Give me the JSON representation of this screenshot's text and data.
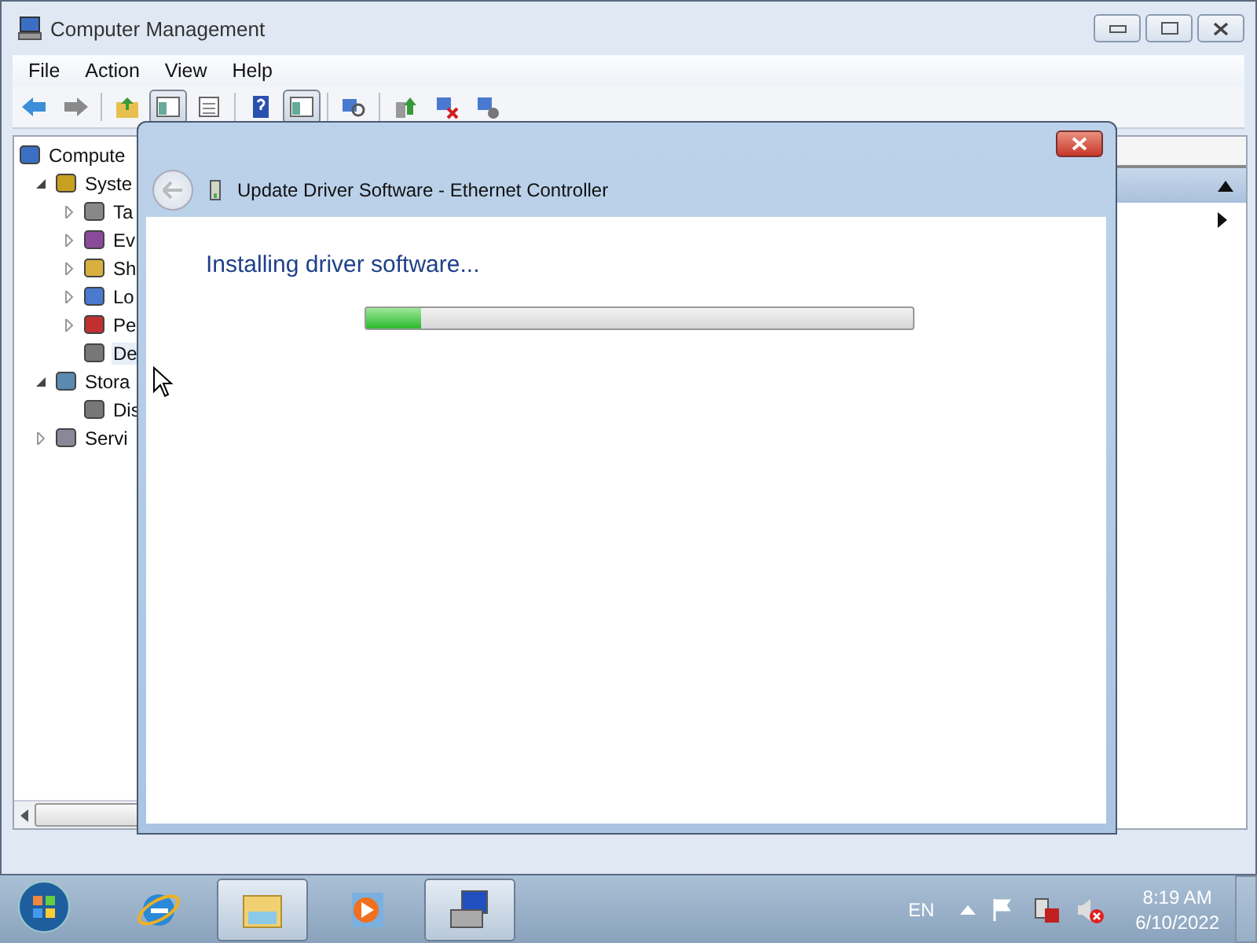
{
  "window": {
    "title": "Computer Management"
  },
  "menu": [
    "File",
    "Action",
    "View",
    "Help"
  ],
  "toolbar": [
    {
      "kind": "back",
      "pressed": false
    },
    {
      "kind": "forward",
      "pressed": false
    },
    {
      "kind": "folder",
      "pressed": false
    },
    {
      "kind": "pane",
      "pressed": true
    },
    {
      "kind": "list",
      "pressed": false
    },
    {
      "kind": "help",
      "pressed": false
    },
    {
      "kind": "pane",
      "pressed": true
    },
    {
      "kind": "scan",
      "pressed": false
    },
    {
      "kind": "update",
      "pressed": false
    },
    {
      "kind": "disable",
      "pressed": false
    },
    {
      "kind": "uninstall",
      "pressed": false
    }
  ],
  "tree": [
    {
      "label": "Compute",
      "kind": "computer",
      "children": [
        {
          "label": "Syste",
          "kind": "tools",
          "expanded": true,
          "children": [
            {
              "label": "Ta",
              "kind": "clock",
              "expanded": false
            },
            {
              "label": "Ev",
              "kind": "log",
              "expanded": false
            },
            {
              "label": "Sh",
              "kind": "share",
              "expanded": false
            },
            {
              "label": "Lo",
              "kind": "users",
              "expanded": false
            },
            {
              "label": "Pe",
              "kind": "gauge",
              "expanded": false
            },
            {
              "label": "De",
              "kind": "device",
              "selected": true
            }
          ]
        },
        {
          "label": "Stora",
          "kind": "storage",
          "expanded": true,
          "children": [
            {
              "label": "Dis",
              "kind": "device"
            }
          ]
        },
        {
          "label": "Servi",
          "kind": "services",
          "expanded": false
        }
      ]
    }
  ],
  "dialog": {
    "title": "Update Driver Software - Ethernet Controller",
    "heading": "Installing driver software...",
    "progress": {
      "level": 0.1
    }
  },
  "taskbar": {
    "apps": [
      {
        "kind": "ie",
        "running": false
      },
      {
        "kind": "explorer",
        "running": true
      },
      {
        "kind": "media",
        "running": false
      },
      {
        "kind": "mgmt",
        "running": true
      }
    ],
    "language": "EN",
    "time": "8:19 AM",
    "date": "6/10/2022"
  }
}
